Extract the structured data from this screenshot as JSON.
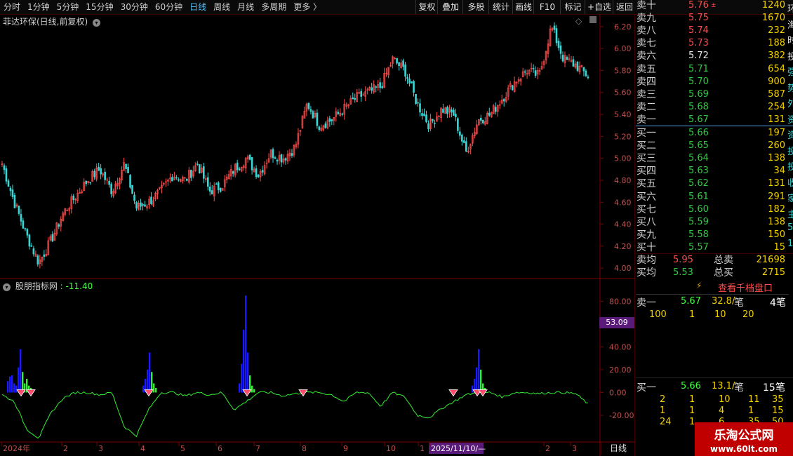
{
  "toolbar": {
    "items": [
      {
        "label": "分时",
        "active": false
      },
      {
        "label": "1分钟",
        "active": false
      },
      {
        "label": "5分钟",
        "active": false
      },
      {
        "label": "15分钟",
        "active": false
      },
      {
        "label": "30分钟",
        "active": false
      },
      {
        "label": "60分钟",
        "active": false
      },
      {
        "label": "日线",
        "active": true
      },
      {
        "label": "周线",
        "active": false
      },
      {
        "label": "月线",
        "active": false
      },
      {
        "label": "多周期",
        "active": false
      },
      {
        "label": "更多 〉",
        "active": false
      }
    ],
    "right_items": [
      "复权",
      "叠加",
      "多股",
      "统计",
      "画线",
      "F10",
      "标记",
      "+自选",
      "返回"
    ]
  },
  "price_chart": {
    "title": "菲达环保(日线,前复权)",
    "y_ticks": [
      "6.20",
      "6.00",
      "5.80",
      "5.60",
      "5.40",
      "5.20",
      "5.00",
      "4.80",
      "4.60",
      "4.40",
      "4.20",
      "4.00"
    ],
    "y_range": [
      3.95,
      6.25
    ],
    "ohlc_keyframes": [
      4.95,
      4.6,
      4.3,
      4.05,
      4.25,
      4.5,
      4.65,
      4.8,
      4.9,
      4.7,
      4.95,
      4.55,
      4.6,
      4.7,
      4.85,
      4.8,
      4.95,
      4.7,
      4.75,
      4.9,
      5.0,
      4.85,
      5.05,
      5.0,
      5.1,
      5.5,
      5.3,
      5.35,
      5.45,
      5.55,
      5.6,
      5.65,
      5.9,
      5.8,
      5.5,
      5.3,
      5.45,
      5.4,
      5.05,
      5.35,
      5.4,
      5.55,
      5.7,
      5.8,
      5.75,
      6.2,
      5.9,
      5.85,
      5.75
    ]
  },
  "indicator": {
    "name": "股朋指标网",
    "value_text": ": -11.40",
    "y_ticks": [
      "80.00",
      "60.00",
      "40.00",
      "20.00",
      "0.00",
      "-20.00"
    ],
    "y_range": [
      -28,
      95
    ],
    "current_value_badge": "53.09",
    "line_keyframes": [
      -2,
      -8,
      -32,
      -40,
      -18,
      -5,
      0,
      0,
      -2,
      0,
      -30,
      -38,
      -15,
      0,
      0,
      -3,
      0,
      -2,
      0,
      -15,
      -8,
      0,
      0,
      -3,
      -1,
      0,
      0,
      -2,
      -8,
      0,
      0,
      -12,
      0,
      -4,
      -20,
      -22,
      -14,
      -8,
      -2,
      0,
      0,
      -4,
      0,
      0,
      -1,
      0,
      0,
      -1,
      -10
    ]
  },
  "time_axis": {
    "labels": [
      "2024年",
      "2",
      "3",
      "4",
      "5",
      "6",
      "7",
      "8",
      "9",
      "10",
      "1",
      "2025/11/10/—",
      "2",
      "3"
    ],
    "period_label": "日线"
  },
  "order_book": {
    "sells": [
      {
        "label": "卖十",
        "price": "5.76",
        "vol": "1240",
        "dir": "up",
        "mark": "±"
      },
      {
        "label": "卖九",
        "price": "5.75",
        "vol": "1670",
        "dir": "up"
      },
      {
        "label": "卖八",
        "price": "5.74",
        "vol": "232",
        "dir": "up"
      },
      {
        "label": "卖七",
        "price": "5.73",
        "vol": "188",
        "dir": "up"
      },
      {
        "label": "卖六",
        "price": "5.72",
        "vol": "382",
        "dir": "flat"
      },
      {
        "label": "卖五",
        "price": "5.71",
        "vol": "654",
        "dir": "down"
      },
      {
        "label": "卖四",
        "price": "5.70",
        "vol": "900",
        "dir": "down"
      },
      {
        "label": "卖三",
        "price": "5.69",
        "vol": "587",
        "dir": "down"
      },
      {
        "label": "卖二",
        "price": "5.68",
        "vol": "254",
        "dir": "down"
      },
      {
        "label": "卖一",
        "price": "5.67",
        "vol": "131",
        "dir": "down"
      }
    ],
    "buys": [
      {
        "label": "买一",
        "price": "5.66",
        "vol": "197",
        "dir": "down"
      },
      {
        "label": "买二",
        "price": "5.65",
        "vol": "260",
        "dir": "down"
      },
      {
        "label": "买三",
        "price": "5.64",
        "vol": "138",
        "dir": "down"
      },
      {
        "label": "买四",
        "price": "5.63",
        "vol": "34",
        "dir": "down"
      },
      {
        "label": "买五",
        "price": "5.62",
        "vol": "131",
        "dir": "down"
      },
      {
        "label": "买六",
        "price": "5.61",
        "vol": "291",
        "dir": "down"
      },
      {
        "label": "买七",
        "price": "5.60",
        "vol": "182",
        "dir": "down"
      },
      {
        "label": "买八",
        "price": "5.59",
        "vol": "138",
        "dir": "down"
      },
      {
        "label": "买九",
        "price": "5.58",
        "vol": "150",
        "dir": "down"
      },
      {
        "label": "买十",
        "price": "5.57",
        "vol": "15",
        "dir": "down"
      }
    ],
    "avg_sell_label": "卖均",
    "avg_sell": "5.95",
    "total_sell_label": "总卖",
    "total_sell": "21698",
    "avg_buy_label": "买均",
    "avg_buy": "5.53",
    "total_buy_label": "总买",
    "total_buy": "2715"
  },
  "level_panel": {
    "button_label": "查看千档盘口",
    "sell1_label": "卖一",
    "sell1_price": "5.67",
    "sell1_per": "32.8/",
    "sell1_unit": "笔",
    "sell1_count": "4笔",
    "sell_queue": [
      "100",
      "1",
      "10",
      "20"
    ],
    "buy1_label": "买一",
    "buy1_price": "5.66",
    "buy1_per": "13.1/",
    "buy1_unit": "笔",
    "buy1_count": "15笔",
    "buy_queue": [
      [
        "2",
        "1",
        "10",
        "11",
        "35"
      ],
      [
        "1",
        "1",
        "4",
        "1",
        "15"
      ],
      [
        "24",
        "1",
        "6",
        "35",
        "50"
      ]
    ]
  },
  "right_edge_chars": [
    "环",
    "海",
    "时",
    "投",
    "强",
    "势",
    "外",
    "资",
    "资",
    "投",
    "投",
    "收",
    "家",
    "主",
    "5",
    "1"
  ],
  "watermark": {
    "title": "乐淘公式网",
    "url": "www.60lt.com"
  },
  "colors": {
    "up": "#ff4d4d",
    "down": "#2ecc40",
    "blue_bar": "#1a1aff",
    "green_bar": "#33ee33",
    "accent": "#4fc3ff",
    "badge": "#5a1a7a"
  }
}
